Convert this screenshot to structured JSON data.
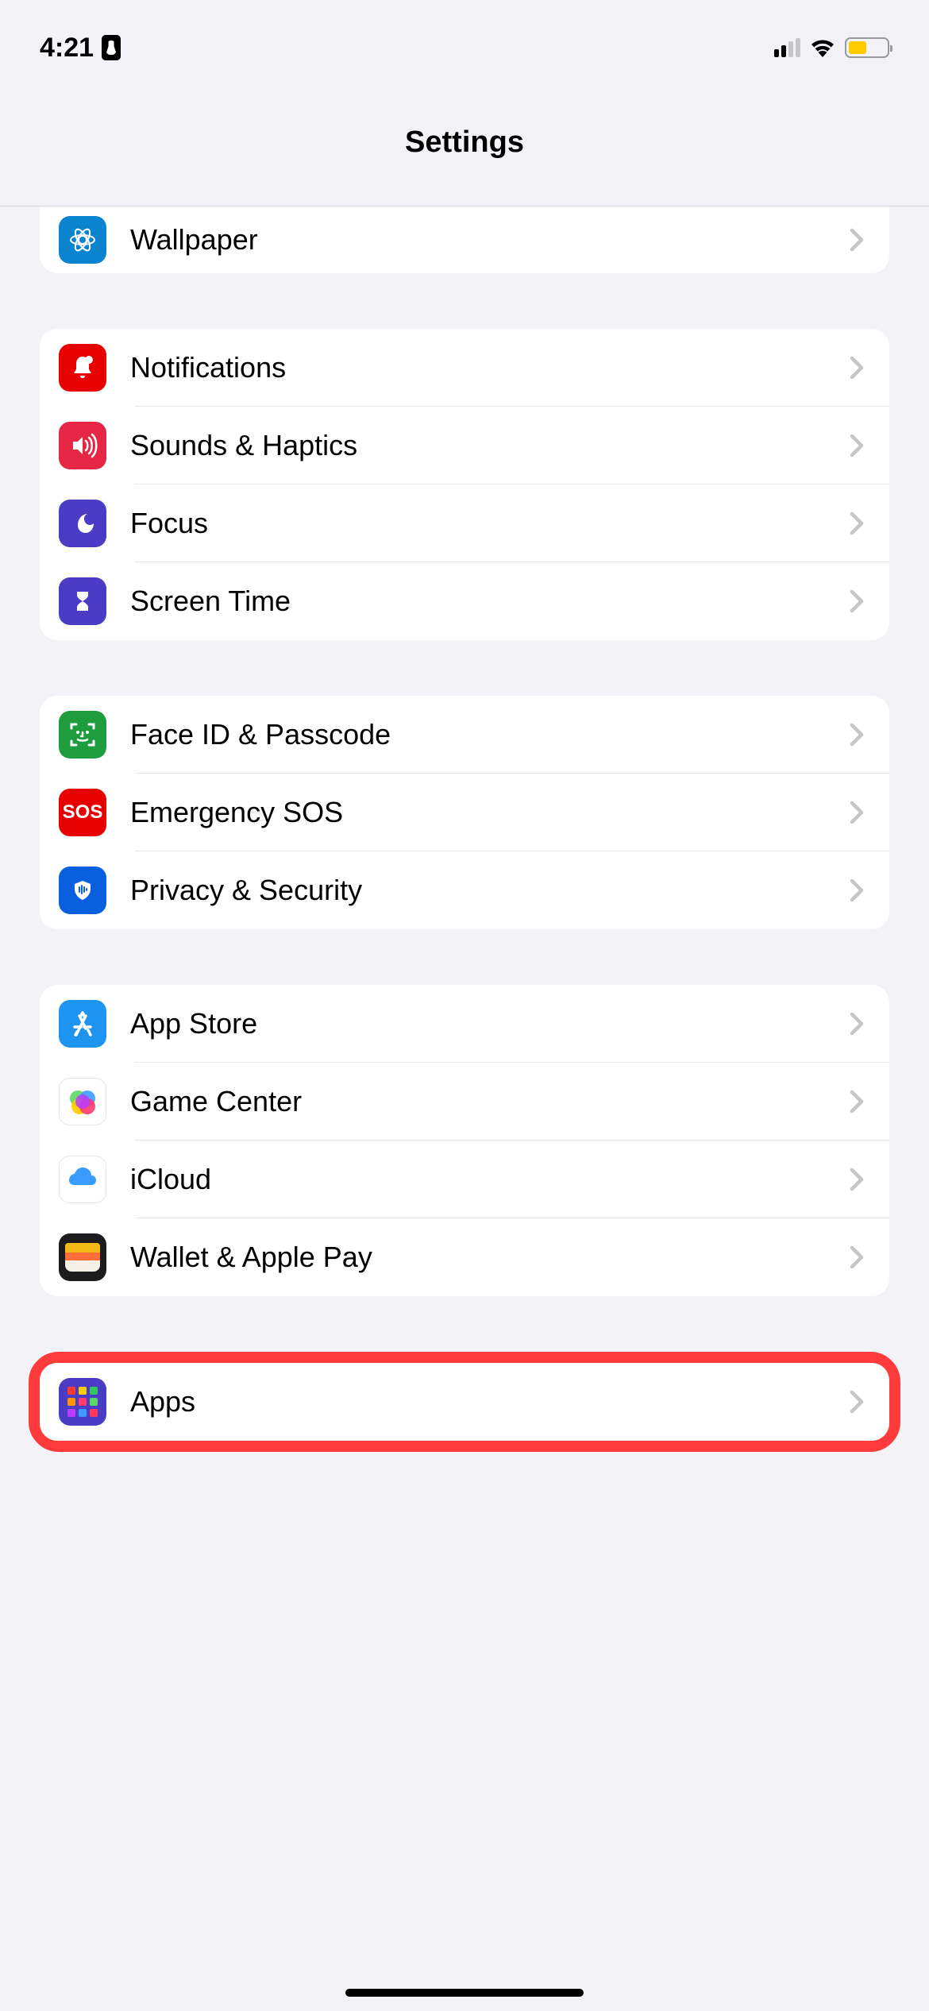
{
  "status": {
    "time": "4:21"
  },
  "header": {
    "title": "Settings"
  },
  "groups": [
    {
      "partial": true,
      "items": [
        {
          "key": "wallpaper",
          "label": "Wallpaper",
          "icon": "wallpaper-icon"
        }
      ]
    },
    {
      "items": [
        {
          "key": "notifications",
          "label": "Notifications",
          "icon": "notifications-icon"
        },
        {
          "key": "sounds",
          "label": "Sounds & Haptics",
          "icon": "sounds-icon"
        },
        {
          "key": "focus",
          "label": "Focus",
          "icon": "focus-icon"
        },
        {
          "key": "screentime",
          "label": "Screen Time",
          "icon": "screentime-icon"
        }
      ]
    },
    {
      "items": [
        {
          "key": "faceid",
          "label": "Face ID & Passcode",
          "icon": "faceid-icon"
        },
        {
          "key": "sos",
          "label": "Emergency SOS",
          "icon": "sos-icon",
          "icon_text": "SOS"
        },
        {
          "key": "privacy",
          "label": "Privacy & Security",
          "icon": "privacy-icon"
        }
      ]
    },
    {
      "items": [
        {
          "key": "appstore",
          "label": "App Store",
          "icon": "appstore-icon"
        },
        {
          "key": "gamecenter",
          "label": "Game Center",
          "icon": "gamecenter-icon"
        },
        {
          "key": "icloud",
          "label": "iCloud",
          "icon": "icloud-icon"
        },
        {
          "key": "wallet",
          "label": "Wallet & Apple Pay",
          "icon": "wallet-icon"
        }
      ]
    },
    {
      "highlighted": true,
      "items": [
        {
          "key": "apps",
          "label": "Apps",
          "icon": "apps-icon"
        }
      ]
    }
  ]
}
